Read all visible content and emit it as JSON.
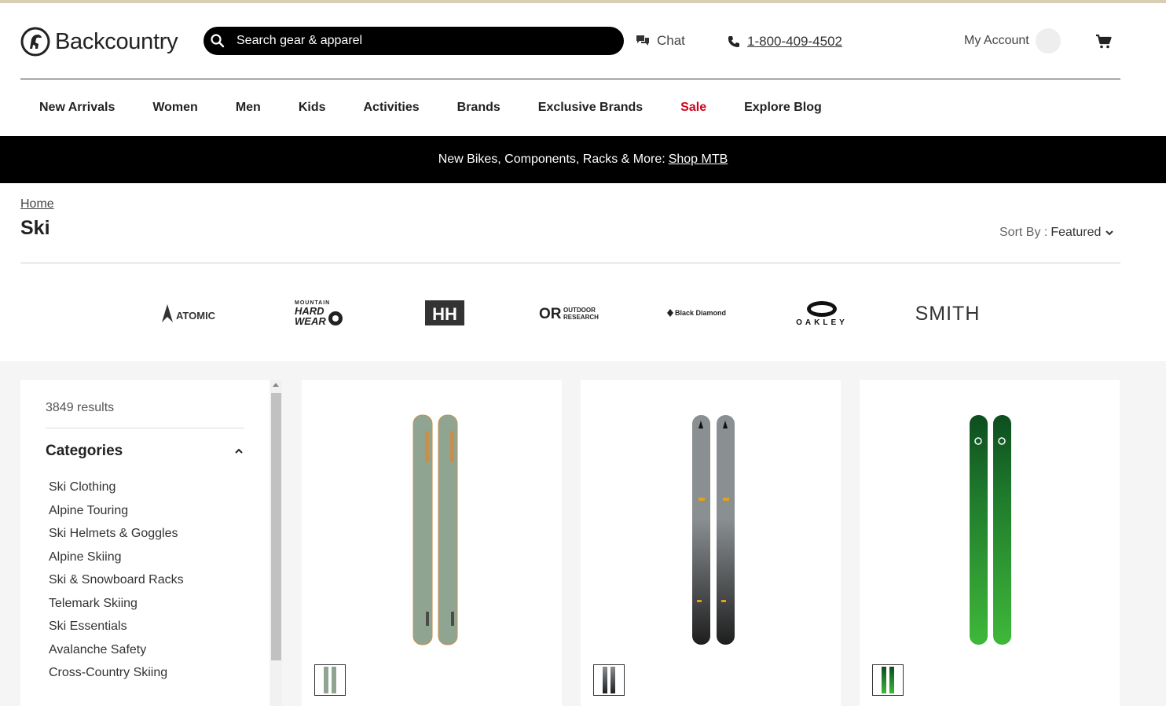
{
  "header": {
    "logo_text": "Backcountry",
    "search_placeholder": "Search gear & apparel",
    "chat_label": "Chat",
    "phone": "1-800-409-4502",
    "account_label": "My Account"
  },
  "nav": {
    "items": [
      "New Arrivals",
      "Women",
      "Men",
      "Kids",
      "Activities",
      "Brands",
      "Exclusive Brands",
      "Sale",
      "Explore Blog"
    ]
  },
  "promo": {
    "text": "New Bikes, Components, Racks & More:",
    "link": "Shop MTB"
  },
  "breadcrumb": {
    "home": "Home"
  },
  "page": {
    "title": "Ski",
    "sort_label": "Sort By :",
    "sort_value": "Featured"
  },
  "brands": {
    "atomic": "ATOMIC",
    "mhw_line1": "MOUNTAIN",
    "mhw_line2": "HARD",
    "mhw_line3": "WEAR",
    "hh": "HH",
    "or_mark": "OR",
    "or_line1": "OUTDOOR",
    "or_line2": "RESEARCH",
    "bd": "Black Diamond",
    "oakley": "OAKLEY",
    "smith": "SMITH"
  },
  "sidebar": {
    "results": "3849 results",
    "categories_title": "Categories",
    "categories": [
      "Ski Clothing",
      "Alpine Touring",
      "Ski Helmets & Goggles",
      "Alpine Skiing",
      "Ski & Snowboard Racks",
      "Telemark Skiing",
      "Ski Essentials",
      "Avalanche Safety",
      "Cross-Country Skiing"
    ]
  },
  "colors": {
    "accent_sale": "#d0021b",
    "promo_bg": "#000000",
    "topline": "#d9cdb3",
    "ski1": "#8fa592",
    "ski2_top": "#8a8f92",
    "ski2_bottom": "#1e1e1e",
    "ski3_top": "#0d4d1f",
    "ski3_bottom": "#3fb83a"
  }
}
